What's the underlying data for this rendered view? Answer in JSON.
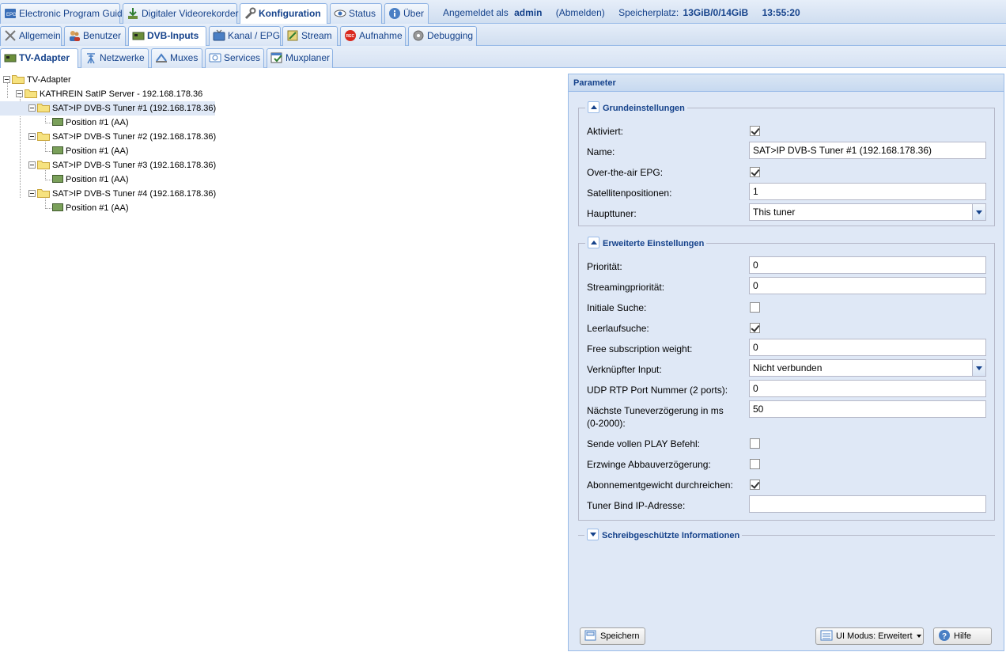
{
  "nav1": {
    "tabs": [
      {
        "label": "Electronic Program Guide",
        "icon": "epg-icon"
      },
      {
        "label": "Digitaler Videorekorder",
        "icon": "download-icon"
      },
      {
        "label": "Konfiguration",
        "icon": "wrench-icon"
      },
      {
        "label": "Status",
        "icon": "eye-icon"
      },
      {
        "label": "Über",
        "icon": "info-icon"
      }
    ],
    "active": "Konfiguration",
    "logged_in_prefix": "Angemeldet als",
    "user": "admin",
    "logout": "(Abmelden)",
    "storage_label": "Speicherplatz:",
    "storage_value": "13GiB/0/14GiB",
    "time": "13:55:20"
  },
  "nav2": {
    "tabs": [
      {
        "label": "Allgemein"
      },
      {
        "label": "Benutzer"
      },
      {
        "label": "DVB-Inputs"
      },
      {
        "label": "Kanal / EPG"
      },
      {
        "label": "Stream"
      },
      {
        "label": "Aufnahme"
      },
      {
        "label": "Debugging"
      }
    ],
    "active": "DVB-Inputs"
  },
  "nav3": {
    "tabs": [
      {
        "label": "TV-Adapter"
      },
      {
        "label": "Netzwerke"
      },
      {
        "label": "Muxes"
      },
      {
        "label": "Services"
      },
      {
        "label": "Muxplaner"
      }
    ],
    "active": "TV-Adapter"
  },
  "tree": {
    "root": "TV-Adapter",
    "server": "KATHREIN SatIP Server - 192.168.178.36",
    "tuners": [
      {
        "label": "SAT>IP DVB-S Tuner #1 (192.168.178.36)",
        "position": "Position #1 (AA)",
        "selected": true
      },
      {
        "label": "SAT>IP DVB-S Tuner #2 (192.168.178.36)",
        "position": "Position #1 (AA)",
        "selected": false
      },
      {
        "label": "SAT>IP DVB-S Tuner #3 (192.168.178.36)",
        "position": "Position #1 (AA)",
        "selected": false
      },
      {
        "label": "SAT>IP DVB-S Tuner #4 (192.168.178.36)",
        "position": "Position #1 (AA)",
        "selected": false
      }
    ]
  },
  "params": {
    "title": "Parameter",
    "basic": {
      "legend": "Grundeinstellungen",
      "aktiviert": {
        "label": "Aktiviert:",
        "checked": true
      },
      "name": {
        "label": "Name:",
        "value": "SAT>IP DVB-S Tuner #1 (192.168.178.36)"
      },
      "ota_epg": {
        "label": "Over-the-air EPG:",
        "checked": true
      },
      "satpos": {
        "label": "Satellitenpositionen:",
        "value": "1"
      },
      "haupttuner": {
        "label": "Haupttuner:",
        "value": "This tuner"
      }
    },
    "advanced": {
      "legend": "Erweiterte Einstellungen",
      "prioritaet": {
        "label": "Priorität:",
        "value": "0"
      },
      "streamprio": {
        "label": "Streamingpriorität:",
        "value": "0"
      },
      "initiale": {
        "label": "Initiale Suche:",
        "checked": false
      },
      "leerlauf": {
        "label": "Leerlaufsuche:",
        "checked": true
      },
      "freesub": {
        "label": "Free subscription weight:",
        "value": "0"
      },
      "verknuepft": {
        "label": "Verknüpfter Input:",
        "value": "Nicht verbunden"
      },
      "udp": {
        "label": "UDP RTP Port Nummer (2 ports):",
        "value": "0"
      },
      "tunedelay": {
        "label1": "Nächste Tuneverzögerung in ms",
        "label2": "(0-2000):",
        "value": "50"
      },
      "sendeplay": {
        "label": "Sende vollen PLAY Befehl:",
        "checked": false
      },
      "abbau": {
        "label": "Erzwinge Abbauverzögerung:",
        "checked": false
      },
      "abo": {
        "label": "Abonnementgewicht durchreichen:",
        "checked": true
      },
      "bindip": {
        "label": "Tuner Bind IP-Adresse:",
        "value": ""
      }
    },
    "readonly": {
      "legend": "Schreibgeschützte Informationen"
    }
  },
  "buttons": {
    "save": "Speichern",
    "ui_mode": "UI Modus: Erweitert",
    "help": "Hilfe"
  }
}
